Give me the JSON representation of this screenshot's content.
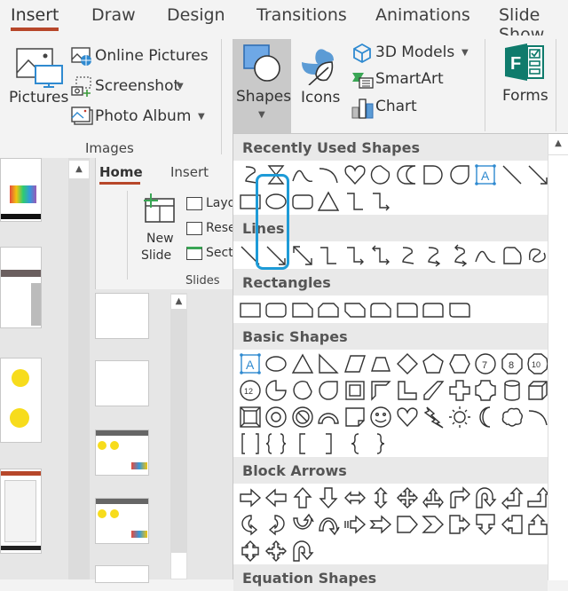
{
  "tabs": [
    {
      "label": "Insert",
      "active": true
    },
    {
      "label": "Draw"
    },
    {
      "label": "Design"
    },
    {
      "label": "Transitions"
    },
    {
      "label": "Animations"
    },
    {
      "label": "Slide Show"
    }
  ],
  "ribbon": {
    "images_group": {
      "label": "Images",
      "pictures": "Pictures",
      "online_pictures": "Online Pictures",
      "screenshot": "Screenshot",
      "photo_album": "Photo Album"
    },
    "shapes": "Shapes",
    "icons": "Icons",
    "models_3d": "3D Models",
    "smartart": "SmartArt",
    "chart": "Chart",
    "forms": "Forms"
  },
  "inner_window": {
    "tabs": [
      {
        "label": "Home",
        "active": true
      },
      {
        "label": "Insert"
      }
    ],
    "new_slide_line1": "New",
    "new_slide_line2": "Slide",
    "layout": "Layout",
    "reset": "Reset",
    "section": "Section",
    "group_label": "Slides"
  },
  "gallery": {
    "sections": [
      {
        "title": "Recently Used Shapes",
        "rows": [
          [
            "curve-s",
            "hourglass",
            "arc-curve",
            "arc",
            "heart",
            "teardrop-circle",
            "moon-d",
            "d-shape",
            "teardrop",
            "text-box",
            "line",
            "arrow-line"
          ],
          [
            "rectangle",
            "oval",
            "rounded-rect",
            "triangle",
            "elbow-connector",
            "elbow-arrow-connector"
          ]
        ]
      },
      {
        "title": "Lines",
        "rows": [
          [
            "line",
            "arrow-line",
            "double-arrow-line",
            "elbow-connector",
            "elbow-arrow-connector",
            "elbow-double-arrow",
            "curve-s",
            "curve-arrow",
            "curve-double-arrow",
            "curve",
            "freeform",
            "scribble"
          ]
        ]
      },
      {
        "title": "Rectangles",
        "rows": [
          [
            "rectangle",
            "rounded-rect",
            "snip-single",
            "snip-same",
            "snip-diagonal",
            "snip-round",
            "round-single",
            "round-same",
            "round-diagonal"
          ]
        ]
      },
      {
        "title": "Basic Shapes",
        "rows": [
          [
            "text-box",
            "oval",
            "triangle",
            "right-triangle",
            "parallelogram",
            "trapezoid",
            "diamond",
            "pentagon",
            "hexagon",
            "heptagon-7",
            "octagon-8",
            "decagon-10"
          ],
          [
            "dodecagon-12",
            "pie",
            "chord",
            "teardrop",
            "frame",
            "half-frame",
            "l-shape",
            "diagonal-stripe",
            "cross",
            "plaque",
            "can",
            "cube"
          ],
          [
            "bevel",
            "donut",
            "no-symbol",
            "block-arc",
            "folded-corner",
            "smiley",
            "heart",
            "lightning",
            "sun",
            "moon",
            "cloud",
            "arc"
          ],
          [
            "double-bracket",
            "double-brace",
            "left-bracket",
            "right-bracket",
            "left-brace",
            "right-brace"
          ]
        ]
      },
      {
        "title": "Block Arrows",
        "rows": [
          [
            "right-arrow",
            "left-arrow",
            "up-arrow",
            "down-arrow",
            "left-right-arrow",
            "up-down-arrow",
            "quad-arrow",
            "left-right-up-arrow",
            "bent-arrow",
            "u-turn-arrow",
            "left-up-arrow",
            "bent-up-arrow"
          ],
          [
            "curved-right-arrow",
            "curved-left-arrow",
            "curved-up-arrow",
            "curved-down-arrow",
            "striped-right-arrow",
            "notched-right-arrow",
            "pentagon-arrow",
            "chevron",
            "right-callout",
            "down-callout",
            "left-callout",
            "up-callout"
          ],
          [
            "up-down-callout",
            "quad-callout",
            "circular-arrow"
          ]
        ]
      },
      {
        "title": "Equation Shapes",
        "rows": []
      }
    ],
    "selected_shape": "arrow-line"
  },
  "colors": {
    "accent_tab": "#b7472a",
    "highlight": "#1e9bd7",
    "forms_green": "#0f7b6c",
    "icon_blue": "#5b9bd5"
  }
}
